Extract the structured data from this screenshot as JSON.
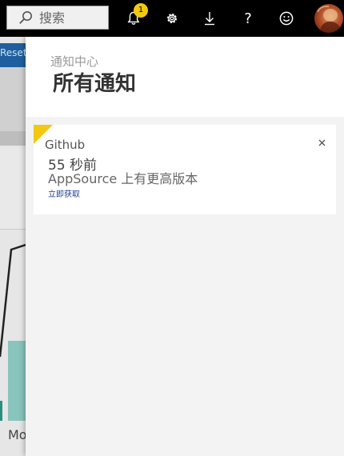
{
  "topbar": {
    "search": {
      "placeholder": "搜索",
      "icon": "search-icon"
    },
    "notifications": {
      "icon": "bell-icon",
      "badge_count": "1"
    },
    "settings": {
      "icon": "gear-icon"
    },
    "download": {
      "icon": "download-icon"
    },
    "help": {
      "icon": "help-icon",
      "glyph": "?"
    },
    "feedback": {
      "icon": "smiley-icon"
    },
    "avatar": {
      "icon": "avatar"
    }
  },
  "background": {
    "strip_text": "Reset",
    "bottom_text": "Mo"
  },
  "panel": {
    "subtitle": "通知中心",
    "title": "所有通知",
    "notifications": [
      {
        "source": "Github",
        "time": "55 秒前",
        "message": "AppSource 上有更高版本",
        "action": "立即获取",
        "accent": "#f2c811"
      }
    ]
  },
  "colors": {
    "topbar": "#000000",
    "accent_yellow": "#f2c811",
    "panel_bg": "#f3f3f3",
    "link": "#1f3f8f"
  }
}
